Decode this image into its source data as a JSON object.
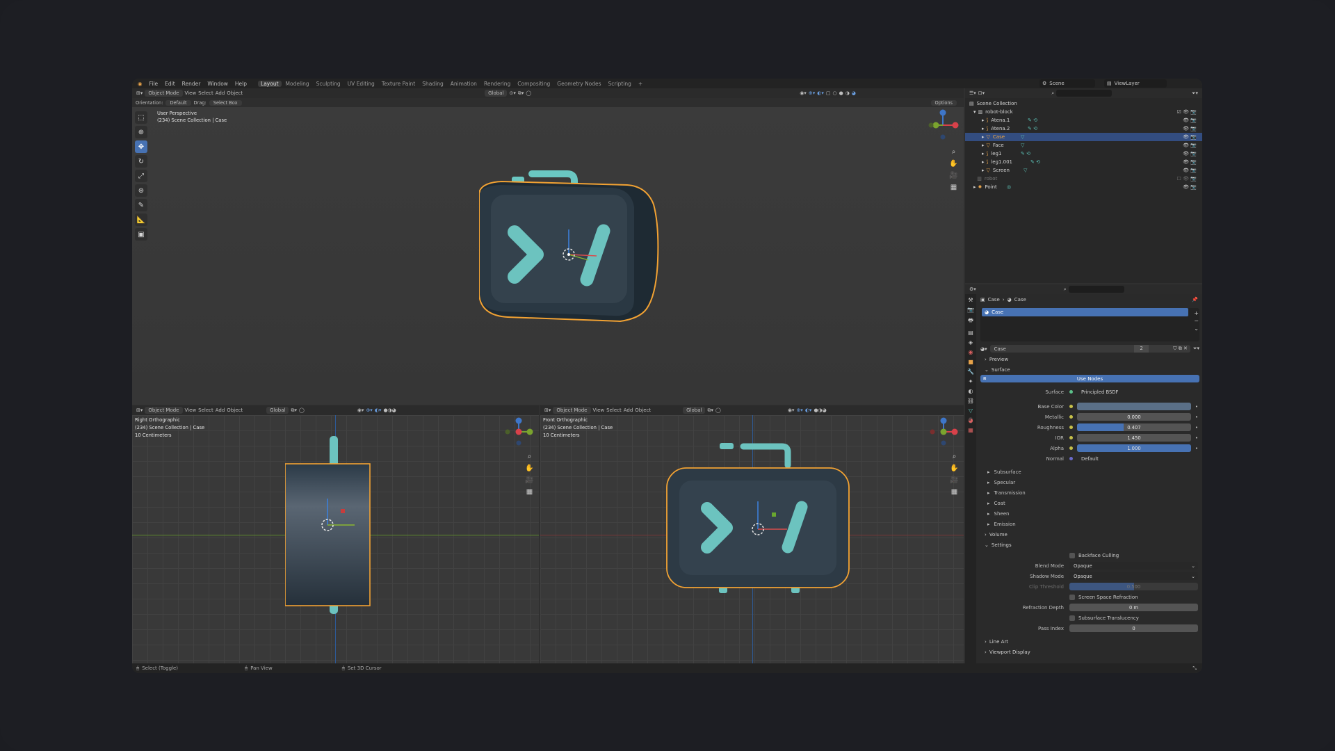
{
  "menu": {
    "items": [
      "File",
      "Edit",
      "Render",
      "Window",
      "Help"
    ],
    "workspaces": [
      "Layout",
      "Modeling",
      "Sculpting",
      "UV Editing",
      "Texture Paint",
      "Shading",
      "Animation",
      "Rendering",
      "Compositing",
      "Geometry Nodes",
      "Scripting"
    ],
    "active_workspace": "Layout",
    "add_tab": "+",
    "scene": "Scene",
    "view_layer": "ViewLayer"
  },
  "viewport_main": {
    "mode": "Object Mode",
    "menus": [
      "View",
      "Select",
      "Add",
      "Object"
    ],
    "transform": "Global",
    "orientation_label": "Orientation:",
    "orientation_value": "Default",
    "drag_label": "Drag:",
    "drag_value": "Select Box",
    "options": "Options",
    "overlay_line1": "User Perspective",
    "overlay_line2": "(234) Scene Collection | Case"
  },
  "viewport_right": {
    "mode": "Object Mode",
    "menus": [
      "View",
      "Select",
      "Add",
      "Object"
    ],
    "transform": "Global",
    "overlay_line1": "Right Orthographic",
    "overlay_line2": "(234) Scene Collection | Case",
    "overlay_line3": "10 Centimeters"
  },
  "viewport_front": {
    "mode": "Object Mode",
    "menus": [
      "View",
      "Select",
      "Add",
      "Object"
    ],
    "transform": "Global",
    "overlay_line1": "Front Orthographic",
    "overlay_line2": "(234) Scene Collection | Case",
    "overlay_line3": "10 Centimeters"
  },
  "outliner": {
    "root": "Scene Collection",
    "collection": "robot-block",
    "items": [
      {
        "name": "Atena.1",
        "selected": false
      },
      {
        "name": "Atena.2",
        "selected": false
      },
      {
        "name": "Case",
        "selected": true
      },
      {
        "name": "Face",
        "selected": false
      },
      {
        "name": "leg1",
        "selected": false
      },
      {
        "name": "leg1.001",
        "selected": false
      },
      {
        "name": "Screen",
        "selected": false
      }
    ],
    "extra": [
      "robot",
      "Point"
    ]
  },
  "properties": {
    "breadcrumb_object": "Case",
    "breadcrumb_material": "Case",
    "material_slot": "Case",
    "material_name": "Case",
    "users": "2",
    "preview_label": "Preview",
    "surface_label": "Surface",
    "use_nodes": "Use Nodes",
    "surface_field_label": "Surface",
    "surface_value": "Principled BSDF",
    "fields": [
      {
        "label": "Base Color",
        "value": "",
        "fill": 1.0,
        "color": "#5a6f87"
      },
      {
        "label": "Metallic",
        "value": "0.000",
        "fill": 0.0
      },
      {
        "label": "Roughness",
        "value": "0.407",
        "fill": 0.407
      },
      {
        "label": "IOR",
        "value": "1.450",
        "fill": 0.0
      },
      {
        "label": "Alpha",
        "value": "1.000",
        "fill": 1.0
      }
    ],
    "normal_label": "Normal",
    "normal_value": "Default",
    "subpanels": [
      "Subsurface",
      "Specular",
      "Transmission",
      "Coat",
      "Sheen",
      "Emission"
    ],
    "volume_label": "Volume",
    "settings_label": "Settings",
    "backface_culling": "Backface Culling",
    "blend_mode_label": "Blend Mode",
    "blend_mode_value": "Opaque",
    "shadow_mode_label": "Shadow Mode",
    "shadow_mode_value": "Opaque",
    "clip_threshold_label": "Clip Threshold",
    "clip_threshold_value": "0.500",
    "ssr": "Screen Space Refraction",
    "refraction_depth_label": "Refraction Depth",
    "refraction_depth_value": "0 m",
    "sss_translucency": "Subsurface Translucency",
    "pass_index_label": "Pass Index",
    "pass_index_value": "0",
    "line_art": "Line Art",
    "viewport_display": "Viewport Display"
  },
  "statusbar": {
    "select": "Select (Toggle)",
    "pan": "Pan View",
    "cursor": "Set 3D Cursor"
  },
  "colors": {
    "selection_orange": "#f2a233",
    "accent_blue": "#4772b3",
    "teal": "#7ecdc9",
    "case_dark": "#2b3640",
    "screen_face": "#374651"
  }
}
